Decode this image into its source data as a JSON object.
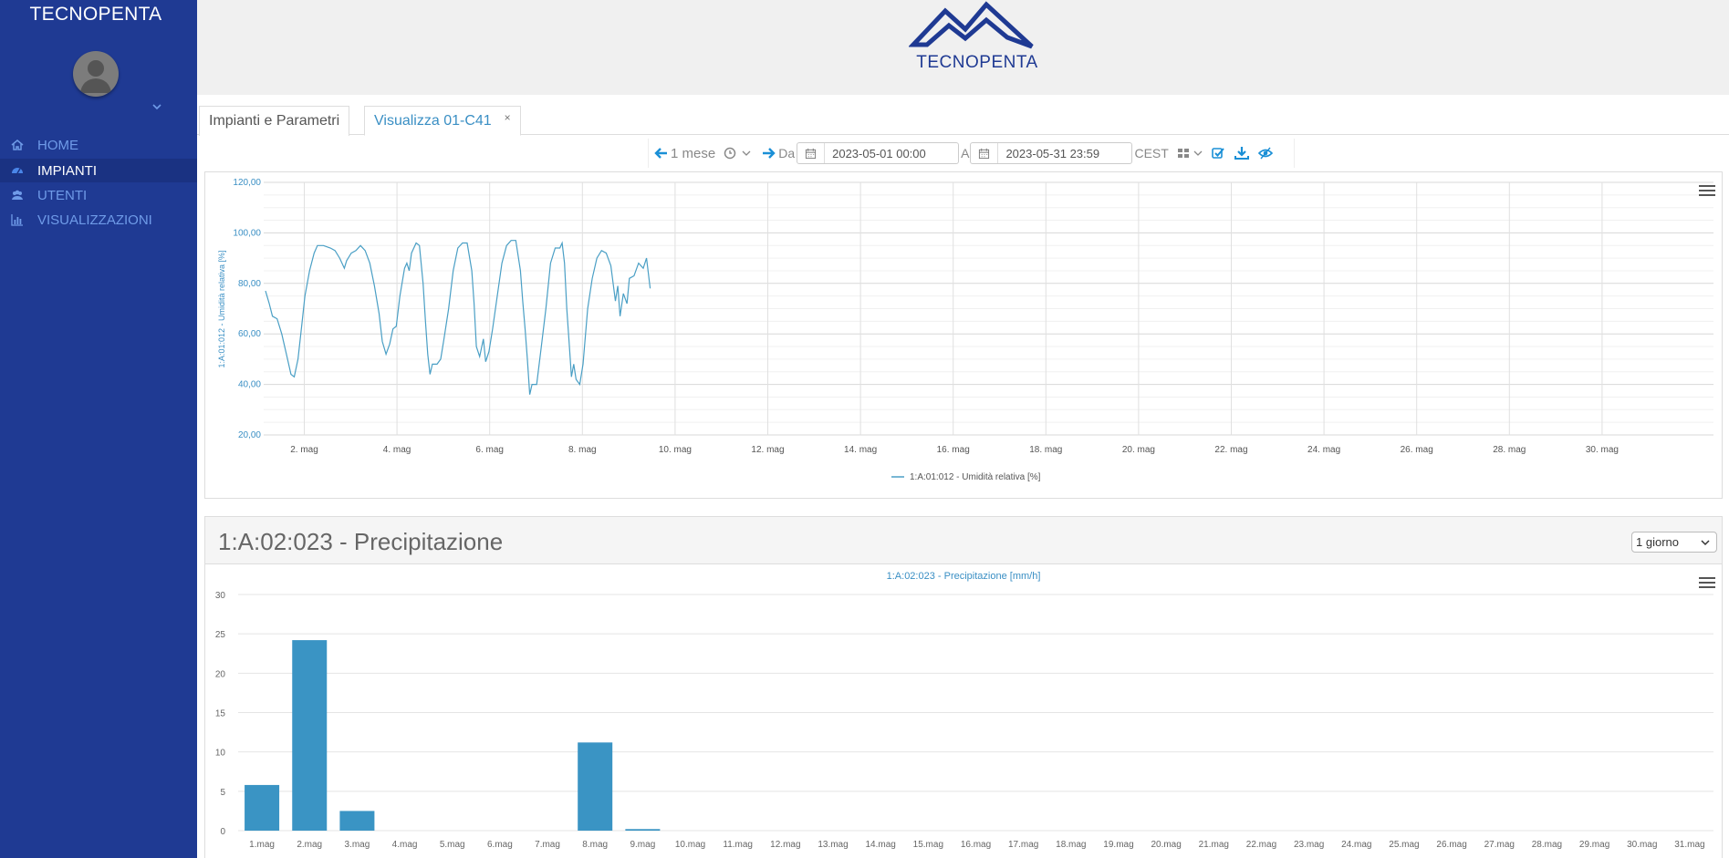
{
  "sidebar": {
    "brand": "TECNOPENTA",
    "items": [
      {
        "label": "HOME",
        "icon": "home-icon"
      },
      {
        "label": "IMPIANTI",
        "icon": "dashboard-icon",
        "active": true
      },
      {
        "label": "UTENTI",
        "icon": "users-icon"
      },
      {
        "label": "VISUALIZZAZIONI",
        "icon": "bar-chart-icon"
      }
    ]
  },
  "header": {
    "logo_text": "TECNOPENTA"
  },
  "tabs": [
    {
      "label": "Impianti e Parametri"
    },
    {
      "label": "Visualizza 01-C41",
      "close": "×",
      "active": true
    }
  ],
  "toolbar": {
    "period": "1 mese",
    "from_label": "Da",
    "from_value": "2023-05-01 00:00",
    "to_label": "A",
    "to_value": "2023-05-31 23:59",
    "timezone": "CEST"
  },
  "colors": {
    "accent": "#3a8fc4",
    "sidebar": "#1f3a93",
    "line": "#4a9fc5",
    "bar": "#3a94c4"
  },
  "chart1": {
    "chart_data": {
      "type": "line",
      "ylabel": "1:A:01:012 - Umidità relativa [%]",
      "ylim": [
        20,
        120
      ],
      "y_ticks": [
        "120,00",
        "100,00",
        "80,00",
        "60,00",
        "40,00",
        "20,00"
      ],
      "x_ticks": [
        "2. mag",
        "4. mag",
        "6. mag",
        "8. mag",
        "10. mag",
        "12. mag",
        "14. mag",
        "16. mag",
        "18. mag",
        "20. mag",
        "22. mag",
        "24. mag",
        "26. mag",
        "28. mag",
        "30. mag"
      ],
      "x_unit": "days since 1 mag",
      "legend": "1:A:01:012 - Umidità relativa [%]",
      "series": [
        {
          "name": "1:A:01:012 - Umidità relativa [%]",
          "points": [
            [
              0.0,
              77
            ],
            [
              0.08,
              72
            ],
            [
              0.15,
              67
            ],
            [
              0.25,
              66
            ],
            [
              0.35,
              60
            ],
            [
              0.45,
              52
            ],
            [
              0.55,
              44
            ],
            [
              0.62,
              43
            ],
            [
              0.7,
              50
            ],
            [
              0.78,
              63
            ],
            [
              0.85,
              75
            ],
            [
              0.95,
              85
            ],
            [
              1.05,
              92
            ],
            [
              1.12,
              95
            ],
            [
              1.25,
              95
            ],
            [
              1.4,
              94
            ],
            [
              1.5,
              93
            ],
            [
              1.6,
              90
            ],
            [
              1.7,
              86
            ],
            [
              1.75,
              89
            ],
            [
              1.85,
              92
            ],
            [
              1.95,
              93
            ],
            [
              2.05,
              95
            ],
            [
              2.15,
              93
            ],
            [
              2.25,
              88
            ],
            [
              2.35,
              79
            ],
            [
              2.45,
              68
            ],
            [
              2.52,
              57
            ],
            [
              2.6,
              52
            ],
            [
              2.68,
              56
            ],
            [
              2.75,
              62
            ],
            [
              2.82,
              63
            ],
            [
              2.9,
              75
            ],
            [
              3.0,
              86
            ],
            [
              3.05,
              88
            ],
            [
              3.1,
              85
            ],
            [
              3.15,
              92
            ],
            [
              3.25,
              96
            ],
            [
              3.32,
              95
            ],
            [
              3.4,
              80
            ],
            [
              3.45,
              65
            ],
            [
              3.5,
              52
            ],
            [
              3.55,
              44
            ],
            [
              3.6,
              48
            ],
            [
              3.7,
              48
            ],
            [
              3.78,
              50
            ],
            [
              3.85,
              58
            ],
            [
              3.95,
              70
            ],
            [
              4.05,
              85
            ],
            [
              4.15,
              94
            ],
            [
              4.25,
              96
            ],
            [
              4.35,
              96
            ],
            [
              4.45,
              85
            ],
            [
              4.5,
              72
            ],
            [
              4.55,
              55
            ],
            [
              4.62,
              51
            ],
            [
              4.7,
              58
            ],
            [
              4.75,
              49
            ],
            [
              4.82,
              53
            ],
            [
              4.9,
              62
            ],
            [
              5.0,
              75
            ],
            [
              5.1,
              88
            ],
            [
              5.2,
              95
            ],
            [
              5.3,
              97
            ],
            [
              5.4,
              97
            ],
            [
              5.5,
              85
            ],
            [
              5.55,
              73
            ],
            [
              5.6,
              62
            ],
            [
              5.65,
              50
            ],
            [
              5.7,
              36
            ],
            [
              5.75,
              40
            ],
            [
              5.85,
              40
            ],
            [
              5.95,
              55
            ],
            [
              6.05,
              70
            ],
            [
              6.15,
              88
            ],
            [
              6.25,
              94
            ],
            [
              6.35,
              94
            ],
            [
              6.4,
              96
            ],
            [
              6.45,
              88
            ],
            [
              6.5,
              70
            ],
            [
              6.55,
              57
            ],
            [
              6.6,
              43
            ],
            [
              6.65,
              48
            ],
            [
              6.7,
              42
            ],
            [
              6.78,
              40
            ],
            [
              6.85,
              48
            ],
            [
              6.95,
              70
            ],
            [
              7.05,
              82
            ],
            [
              7.15,
              90
            ],
            [
              7.25,
              93
            ],
            [
              7.35,
              92
            ],
            [
              7.45,
              87
            ],
            [
              7.5,
              80
            ],
            [
              7.55,
              73
            ],
            [
              7.6,
              79
            ],
            [
              7.65,
              67
            ],
            [
              7.72,
              76
            ],
            [
              7.8,
              72
            ],
            [
              7.85,
              82
            ],
            [
              7.95,
              83
            ],
            [
              8.05,
              88
            ],
            [
              8.15,
              86
            ],
            [
              8.22,
              90
            ],
            [
              8.3,
              78
            ]
          ]
        }
      ]
    }
  },
  "panel2": {
    "title": "1:A:02:023 - Precipitazione",
    "range_select": "1 giorno",
    "chart_data": {
      "type": "bar",
      "title": "1:A:02:023 - Precipitazione [mm/h]",
      "ylim": [
        0,
        30
      ],
      "y_ticks": [
        "30",
        "25",
        "20",
        "15",
        "10",
        "5",
        "0"
      ],
      "categories": [
        "1.mag",
        "2.mag",
        "3.mag",
        "4.mag",
        "5.mag",
        "6.mag",
        "7.mag",
        "8.mag",
        "9.mag",
        "10.mag",
        "11.mag",
        "12.mag",
        "13.mag",
        "14.mag",
        "15.mag",
        "16.mag",
        "17.mag",
        "18.mag",
        "19.mag",
        "20.mag",
        "21.mag",
        "22.mag",
        "23.mag",
        "24.mag",
        "25.mag",
        "26.mag",
        "27.mag",
        "28.mag",
        "29.mag",
        "30.mag",
        "31.mag"
      ],
      "values": [
        5.8,
        24.2,
        2.5,
        0,
        0,
        0,
        0,
        11.2,
        0.2,
        0,
        0,
        0,
        0,
        0,
        0,
        0,
        0,
        0,
        0,
        0,
        0,
        0,
        0,
        0,
        0,
        0,
        0,
        0,
        0,
        0,
        0
      ]
    }
  }
}
